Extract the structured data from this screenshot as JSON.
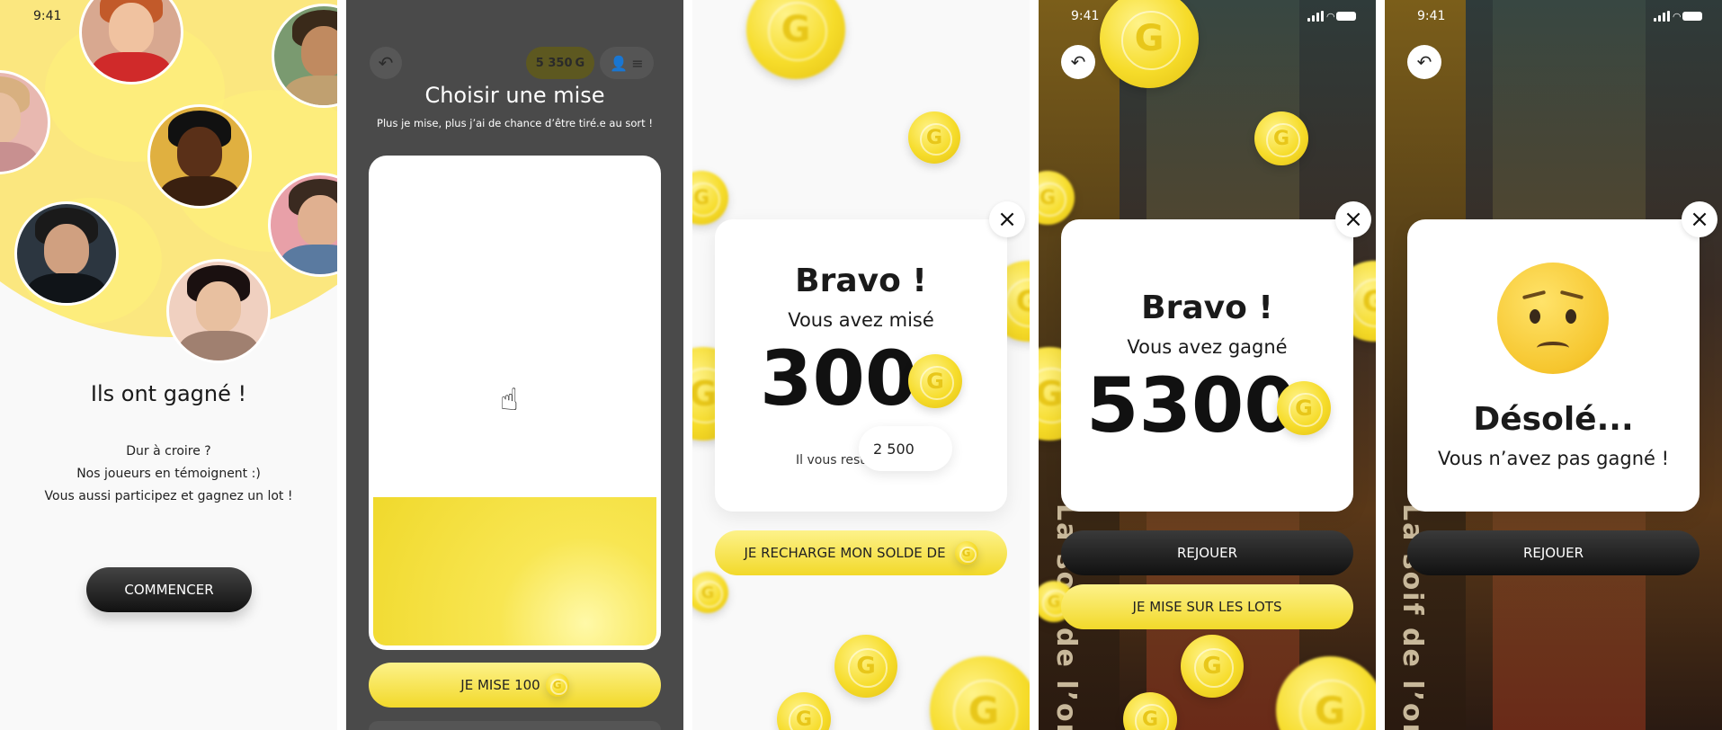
{
  "status_bar": {
    "time": "9:41"
  },
  "screen1": {
    "title": "Ils ont gagné !",
    "desc_lines": [
      "Dur à croire ?",
      "Nos joueurs en témoignent :)",
      "Vous aussi participez et gagnez un lot !"
    ],
    "cta_label": "COMMENCER"
  },
  "screen2": {
    "balance": "5 350",
    "title": "Choisir une mise",
    "subtitle": "Plus je mise, plus j’ai de chance d’être tiré.e au sort !",
    "bet_button_label": "JE MISE 100"
  },
  "screen3": {
    "title": "Bravo !",
    "subtitle": "Vous avez misé",
    "amount": "300",
    "remaining_label": "Il vous reste",
    "remaining_value": "2 500",
    "recharge_button_label": "JE RECHARGE MON SOLDE DE"
  },
  "screen4": {
    "title": "Bravo !",
    "subtitle": "Vous avez gagné",
    "amount": "5300",
    "replay_label": "REJOUER",
    "bet_lots_label": "JE MISE SUR LES LOTS",
    "background_text": "La soif de l’or"
  },
  "screen5": {
    "title": "Désolé...",
    "subtitle": "Vous n’avez pas gagné !",
    "replay_label": "REJOUER",
    "background_text": "La soif de l’or"
  },
  "colors": {
    "accent_yellow": "#f6dc2a",
    "dark_button": "#1a1a1a",
    "blob_yellow": "#fbe77f"
  }
}
